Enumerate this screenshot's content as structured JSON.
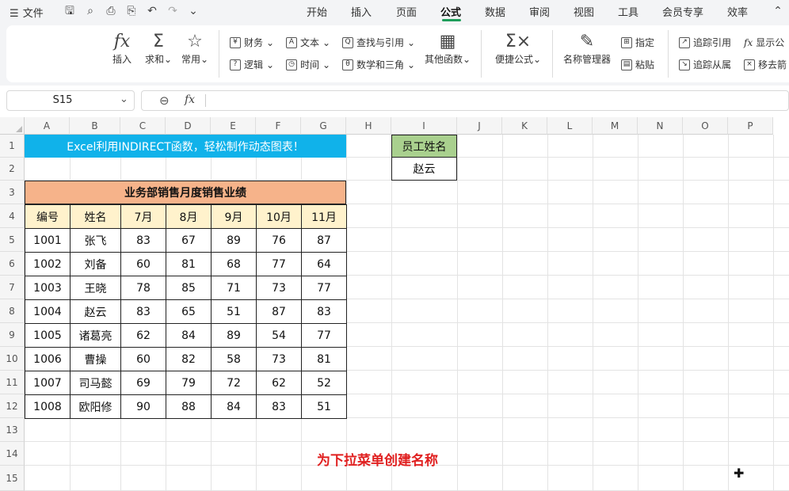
{
  "menu": {
    "file_label": "文件",
    "tabs": [
      "开始",
      "插入",
      "页面",
      "公式",
      "数据",
      "审阅",
      "视图",
      "工具",
      "会员专享",
      "效率"
    ],
    "active_tab": "公式"
  },
  "ribbon": {
    "insert_fn": "插入",
    "autosum": "求和",
    "common": "常用",
    "finance": "财务",
    "logic": "逻辑",
    "text": "文本",
    "datetime": "时间",
    "lookup": "查找与引用",
    "mathtrig": "数学和三角",
    "other_fn": "其他函数",
    "quick_formula": "便捷公式",
    "name_manager": "名称管理器",
    "define": "指定",
    "paste": "粘贴",
    "trace_precedents": "追踪引用",
    "trace_dependents": "追踪从属",
    "show_formula": "显示公",
    "remove_arrows": "移去箭"
  },
  "formula_bar": {
    "cell_ref": "S15",
    "fx": "fx",
    "formula": ""
  },
  "columns": [
    "A",
    "B",
    "C",
    "D",
    "E",
    "F",
    "G",
    "H",
    "I",
    "J",
    "K",
    "L",
    "M",
    "N",
    "O",
    "P"
  ],
  "rows": [
    "1",
    "2",
    "3",
    "4",
    "5",
    "6",
    "7",
    "8",
    "9",
    "10",
    "11",
    "12",
    "13",
    "14",
    "15"
  ],
  "sheet": {
    "banner": "Excel利用INDIRECT函数，轻松制作动态图表！",
    "table_title": "业务部销售月度销售业绩",
    "headers": [
      "编号",
      "姓名",
      "7月",
      "8月",
      "9月",
      "10月",
      "11月"
    ],
    "records": [
      [
        "1001",
        "张飞",
        "83",
        "67",
        "89",
        "76",
        "87"
      ],
      [
        "1002",
        "刘备",
        "60",
        "81",
        "68",
        "77",
        "64"
      ],
      [
        "1003",
        "王晓",
        "78",
        "85",
        "71",
        "73",
        "77"
      ],
      [
        "1004",
        "赵云",
        "83",
        "65",
        "51",
        "87",
        "83"
      ],
      [
        "1005",
        "诸葛亮",
        "62",
        "84",
        "89",
        "54",
        "77"
      ],
      [
        "1006",
        "曹操",
        "60",
        "82",
        "58",
        "73",
        "81"
      ],
      [
        "1007",
        "司马懿",
        "69",
        "79",
        "72",
        "62",
        "52"
      ],
      [
        "1008",
        "欧阳修",
        "90",
        "88",
        "84",
        "83",
        "51"
      ]
    ],
    "employee_label": "员工姓名",
    "employee_value": "赵云",
    "caption": "为下拉菜单创建名称"
  },
  "colors": {
    "banner_bg": "#10b2ea",
    "title_bg": "#f6b38a",
    "header_bg": "#fff2cc",
    "label_bg": "#a9d08e",
    "caption": "#e02020",
    "accent": "#1e9e5a"
  }
}
